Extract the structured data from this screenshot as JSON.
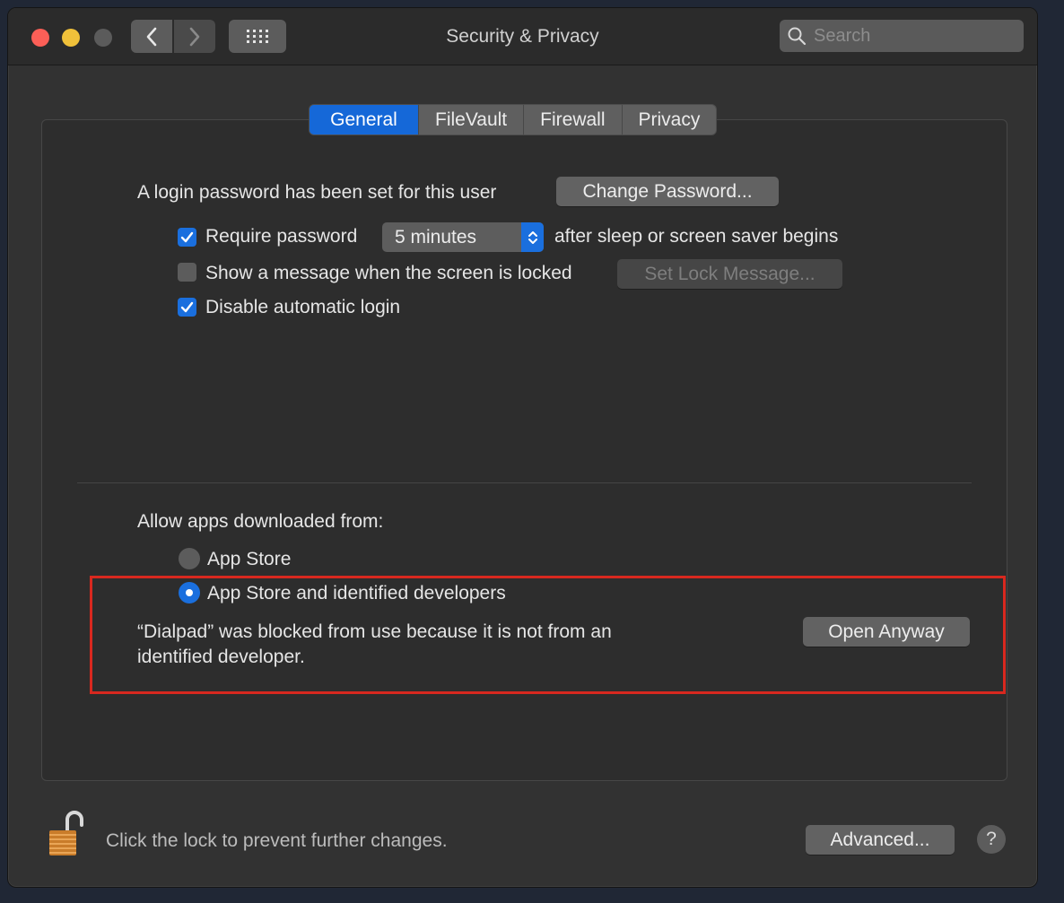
{
  "window": {
    "title": "Security & Privacy"
  },
  "search": {
    "placeholder": "Search"
  },
  "tabs": [
    {
      "label": "General",
      "active": true
    },
    {
      "label": "FileVault",
      "active": false
    },
    {
      "label": "Firewall",
      "active": false
    },
    {
      "label": "Privacy",
      "active": false
    }
  ],
  "general": {
    "login_password_text": "A login password has been set for this user",
    "change_password_label": "Change Password...",
    "require_password": {
      "label": "Require password",
      "checked": true,
      "selected_interval": "5 minutes",
      "suffix": "after sleep or screen saver begins"
    },
    "show_message": {
      "label": "Show a message when the screen is locked",
      "checked": false,
      "button_label": "Set Lock Message..."
    },
    "disable_auto_login": {
      "label": "Disable automatic login",
      "checked": true
    }
  },
  "downloads": {
    "heading": "Allow apps downloaded from:",
    "options": [
      {
        "label": "App Store",
        "selected": false
      },
      {
        "label": "App Store and identified developers",
        "selected": true
      }
    ],
    "blocked_line1": "“Dialpad” was blocked from use because it is not from an",
    "blocked_line2": "identified developer.",
    "open_anyway_label": "Open Anyway"
  },
  "footer": {
    "lock_text": "Click the lock to prevent further changes.",
    "advanced_label": "Advanced...",
    "help_label": "?"
  },
  "colors": {
    "accent": "#1a6fde",
    "highlight_box": "#d8281f",
    "window_bg": "#323232"
  }
}
